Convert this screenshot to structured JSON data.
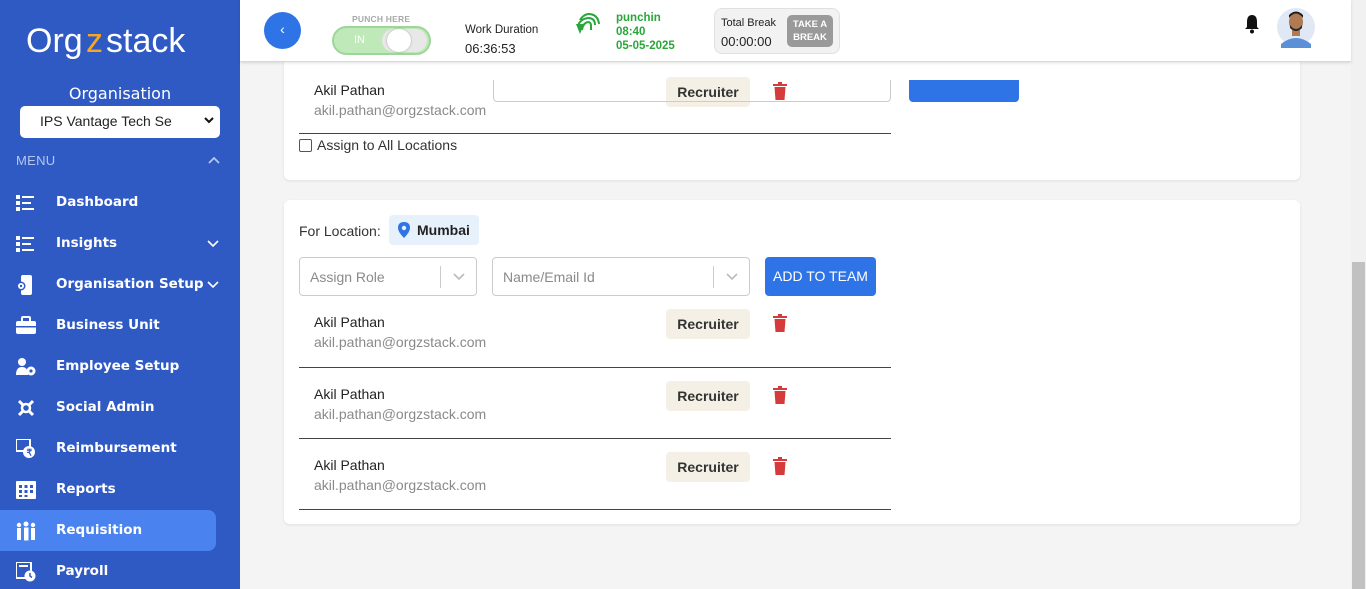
{
  "sidebar": {
    "logo_text": "Orgzstack",
    "org_title": "Organisation",
    "org_selected": "IPS Vantage Tech Se",
    "menu_label": "MENU",
    "items": [
      {
        "label": "Dashboard",
        "icon": "dashboard-icon",
        "has_chevron": false
      },
      {
        "label": "Insights",
        "icon": "insights-icon",
        "has_chevron": true
      },
      {
        "label": "Organisation Setup",
        "icon": "org-setup-icon",
        "has_chevron": true
      },
      {
        "label": "Business Unit",
        "icon": "briefcase-icon",
        "has_chevron": false
      },
      {
        "label": "Employee Setup",
        "icon": "employee-setup-icon",
        "has_chevron": false
      },
      {
        "label": "Social Admin",
        "icon": "social-admin-icon",
        "has_chevron": false
      },
      {
        "label": "Reimbursement",
        "icon": "reimbursement-icon",
        "has_chevron": false
      },
      {
        "label": "Reports",
        "icon": "reports-icon",
        "has_chevron": false
      },
      {
        "label": "Requisition",
        "icon": "requisition-icon",
        "has_chevron": false,
        "active": true
      },
      {
        "label": "Payroll",
        "icon": "payroll-icon",
        "has_chevron": false
      }
    ]
  },
  "header": {
    "back_label": "‹",
    "punch_label": "PUNCH HERE",
    "punch_state": "IN",
    "work_duration_label": "Work Duration",
    "work_duration_value": "06:36:53",
    "punchin_label": "punchin",
    "punchin_time": "08:40",
    "punchin_date": "05-05-2025",
    "total_break_label": "Total Break",
    "total_break_value": "00:00:00",
    "take_break_line1": "TAKE A",
    "take_break_line2": "BREAK"
  },
  "card1": {
    "members": [
      {
        "name": "Akil Pathan",
        "email": "akil.pathan@orgzstack.com",
        "role": "Recruiter"
      }
    ],
    "assign_all_label": "Assign to All Locations"
  },
  "card2": {
    "for_location_label": "For Location:",
    "location": "Mumbai",
    "role_placeholder": "Assign Role",
    "name_placeholder": "Name/Email Id",
    "add_button": "ADD TO TEAM",
    "members": [
      {
        "name": "Akil Pathan",
        "email": "akil.pathan@orgzstack.com",
        "role": "Recruiter"
      },
      {
        "name": "Akil Pathan",
        "email": "akil.pathan@orgzstack.com",
        "role": "Recruiter"
      },
      {
        "name": "Akil Pathan",
        "email": "akil.pathan@orgzstack.com",
        "role": "Recruiter"
      }
    ]
  },
  "colors": {
    "sidebar_bg": "#2f5ac4",
    "active_item": "#4a83ef",
    "primary_button": "#2f74e6",
    "punch_green": "#2aa63a",
    "delete_red": "#d63a3a"
  }
}
